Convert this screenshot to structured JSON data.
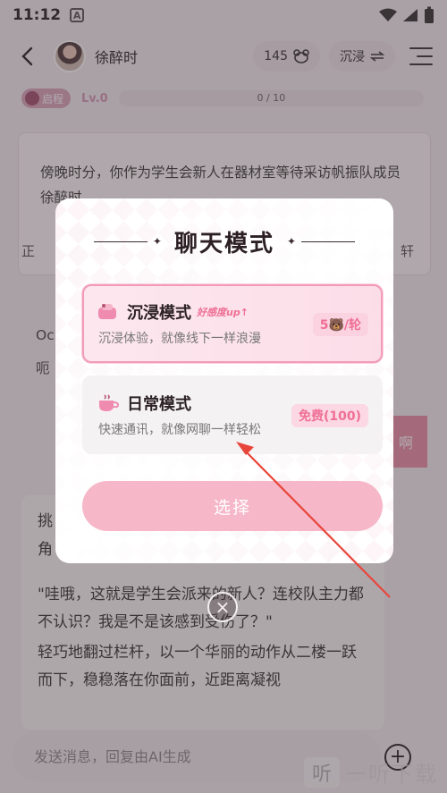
{
  "status_bar": {
    "time": "11:12",
    "a_icon": "A"
  },
  "header": {
    "character_name": "徐醉时",
    "coins": "145",
    "mode_label": "沉浸"
  },
  "level": {
    "badge": "启程",
    "level": "Lv.0",
    "progress_text": "0 / 10",
    "progress_fraction": 0.0
  },
  "story": {
    "text": "傍晚时分，你作为学生会新人在器材室等待采访帆振队成员徐醉时。",
    "line2_left": "正",
    "line2_right": "轩"
  },
  "chat": {
    "fragment1": "Oc",
    "fragment2": "呃",
    "bubble_char": "啊",
    "reply_top_left": "挑",
    "reply_top_left2": "角",
    "reply_paragraphs": [
      "\"哇哦，这就是学生会派来的新人？连校队主力都不认识？我是不是该感到受伤了？\"",
      "轻巧地翻过栏杆，以一个华丽的动作从二楼一跃而下，稳稳落在你面前，近距离凝视"
    ]
  },
  "input": {
    "placeholder": "发送消息，回复由AI生成"
  },
  "watermark": {
    "logo": "听",
    "text": "一听下载"
  },
  "modal": {
    "title": "聊天模式",
    "modes": [
      {
        "name": "沉浸模式",
        "tag": "好感度up↑",
        "desc": "沉浸体验，就像线下一样浪漫",
        "price": "5🐻/轮",
        "icon": "immersive-mode-icon",
        "selected": true
      },
      {
        "name": "日常模式",
        "tag": "",
        "desc": "快速通讯，就像网聊一样轻松",
        "price": "免费(100)",
        "icon": "daily-mode-icon",
        "selected": false
      }
    ],
    "select_label": "选择",
    "close_icon": "×"
  },
  "colors": {
    "accent_pink": "#ef6f96",
    "selected_border": "#f29ab7",
    "button_pink": "#f6b7c9",
    "annotation_arrow": "#e8453a"
  }
}
